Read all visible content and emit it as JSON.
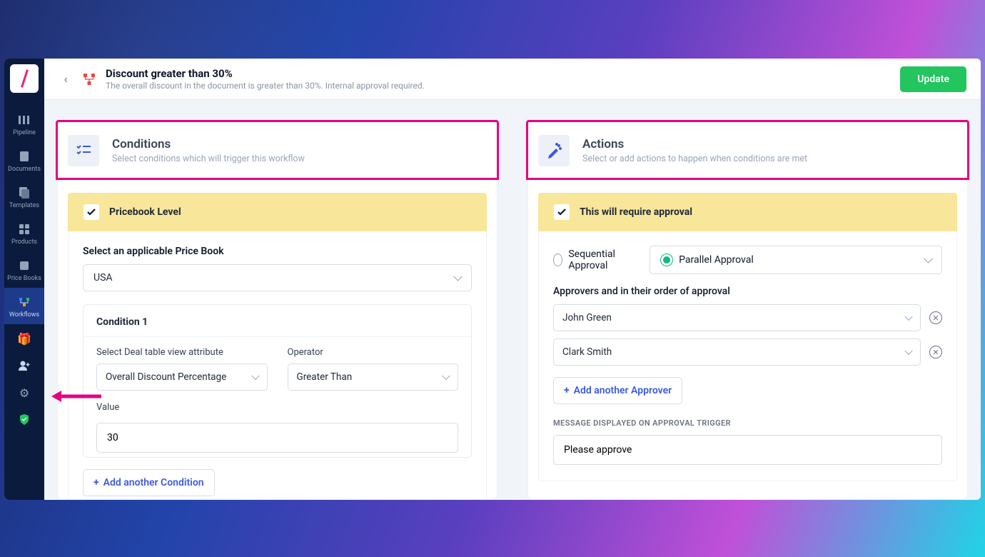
{
  "sidebar": {
    "items": [
      {
        "label": "Pipeline"
      },
      {
        "label": "Documents"
      },
      {
        "label": "Templates"
      },
      {
        "label": "Products"
      },
      {
        "label": "Price Books"
      },
      {
        "label": "Workflows"
      }
    ]
  },
  "header": {
    "title": "Discount greater than 30%",
    "subtitle": "The overall discount in the document is greater than 30%. Internal approval required.",
    "update_btn": "Update"
  },
  "conditions": {
    "title": "Conditions",
    "subtitle": "Select conditions which will trigger this workflow",
    "section_label": "Pricebook Level",
    "pricebook_label": "Select an applicable Price Book",
    "pricebook_value": "USA",
    "condition_card": {
      "title": "Condition 1",
      "attr_label": "Select Deal table view attribute",
      "attr_value": "Overall Discount Percentage",
      "op_label": "Operator",
      "op_value": "Greater Than",
      "val_label": "Value",
      "val_value": "30"
    },
    "add_condition": "Add another Condition"
  },
  "actions": {
    "title": "Actions",
    "subtitle": "Select or add actions to happen when conditions are met",
    "section_label": "This will require approval",
    "approval_modes": {
      "sequential": "Sequential Approval",
      "parallel": "Parallel Approval",
      "selected": "parallel"
    },
    "approvers_label": "Approvers and in their order of approval",
    "approvers": [
      "John Green",
      "Clark Smith"
    ],
    "add_approver": "Add another Approver",
    "msg_label": "MESSAGE DISPLAYED ON APPROVAL TRIGGER",
    "msg_value": "Please approve"
  }
}
